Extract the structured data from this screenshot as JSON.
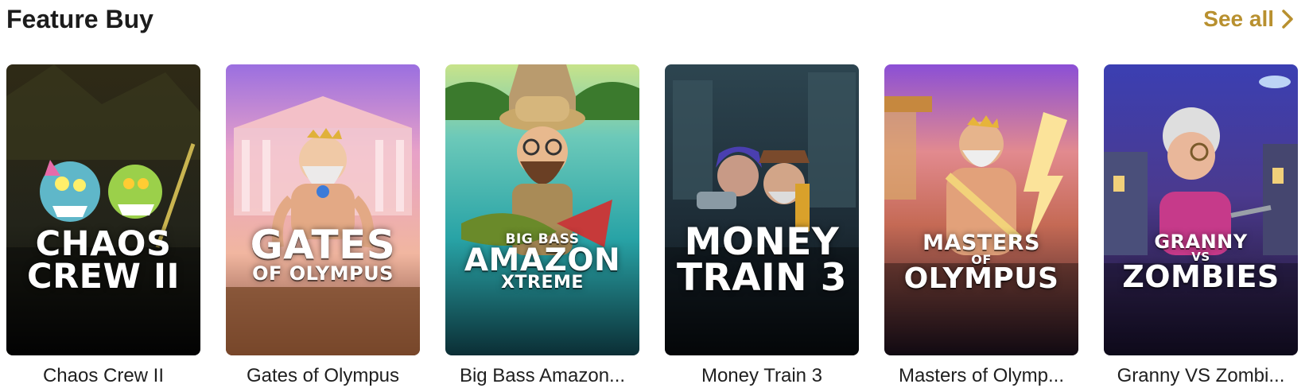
{
  "section": {
    "title": "Feature Buy",
    "see_all_label": "See all"
  },
  "games": [
    {
      "name": "Chaos Crew II",
      "logo_lines": [
        "CHAOS",
        "CREW II"
      ],
      "icon": "chaos-crew-cover"
    },
    {
      "name": "Gates of Olympus",
      "logo_lines": [
        "GATES",
        "OF OLYMPUS"
      ],
      "icon": "zeus-temple-cover"
    },
    {
      "name": "Big Bass Amazon...",
      "logo_lines": [
        "BIG BASS",
        "AMAZON",
        "XTREME"
      ],
      "icon": "explorer-fish-cover"
    },
    {
      "name": "Money Train 3",
      "logo_lines": [
        "MONEY",
        "TRAIN 3"
      ],
      "icon": "train-heist-cover"
    },
    {
      "name": "Masters of Olymp...",
      "logo_lines": [
        "MASTERS",
        "OF",
        "OLYMPUS"
      ],
      "icon": "zeus-lightning-cover"
    },
    {
      "name": "Granny VS Zombi...",
      "logo_lines": [
        "GRANNY",
        "VS",
        "ZOMBIES"
      ],
      "icon": "granny-cover"
    }
  ],
  "colors": {
    "accent": "#b8902f",
    "text": "#1c1c1c"
  }
}
